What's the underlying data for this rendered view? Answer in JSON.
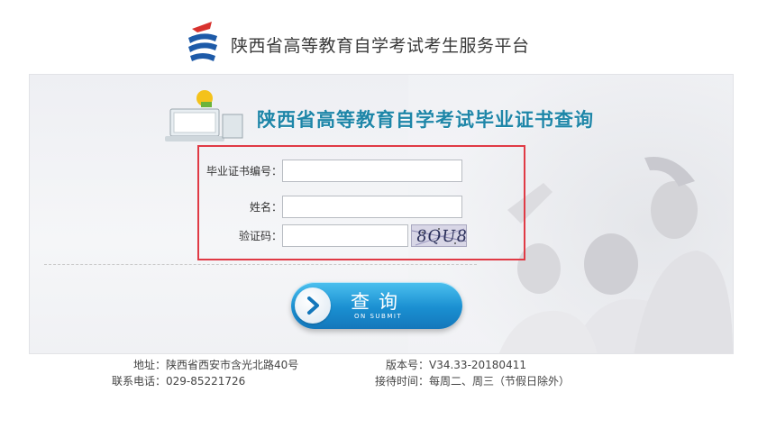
{
  "header": {
    "site_title": "陕西省高等教育自学考试考生服务平台"
  },
  "panel": {
    "title": "陕西省高等教育自学考试毕业证书查询"
  },
  "form": {
    "certificate_label": "毕业证书编号：",
    "certificate_value": "",
    "name_label": "姓名：",
    "name_value": "",
    "captcha_label": "验证码：",
    "captcha_value": "",
    "captcha_text": "8QU8"
  },
  "submit": {
    "label": "查询",
    "sub_label": "ON SUBMIT"
  },
  "footer": {
    "address": "地址：陕西省西安市含光北路40号",
    "phone": "联系电话：029-85221726",
    "version": "版本号：V34.33-20180411",
    "hours": "接待时间：每周二、周三（节假日除外）"
  },
  "colors": {
    "accent_title": "#1e86a8",
    "highlight_border": "#e03a45",
    "button_blue": "#1a8fd1"
  }
}
